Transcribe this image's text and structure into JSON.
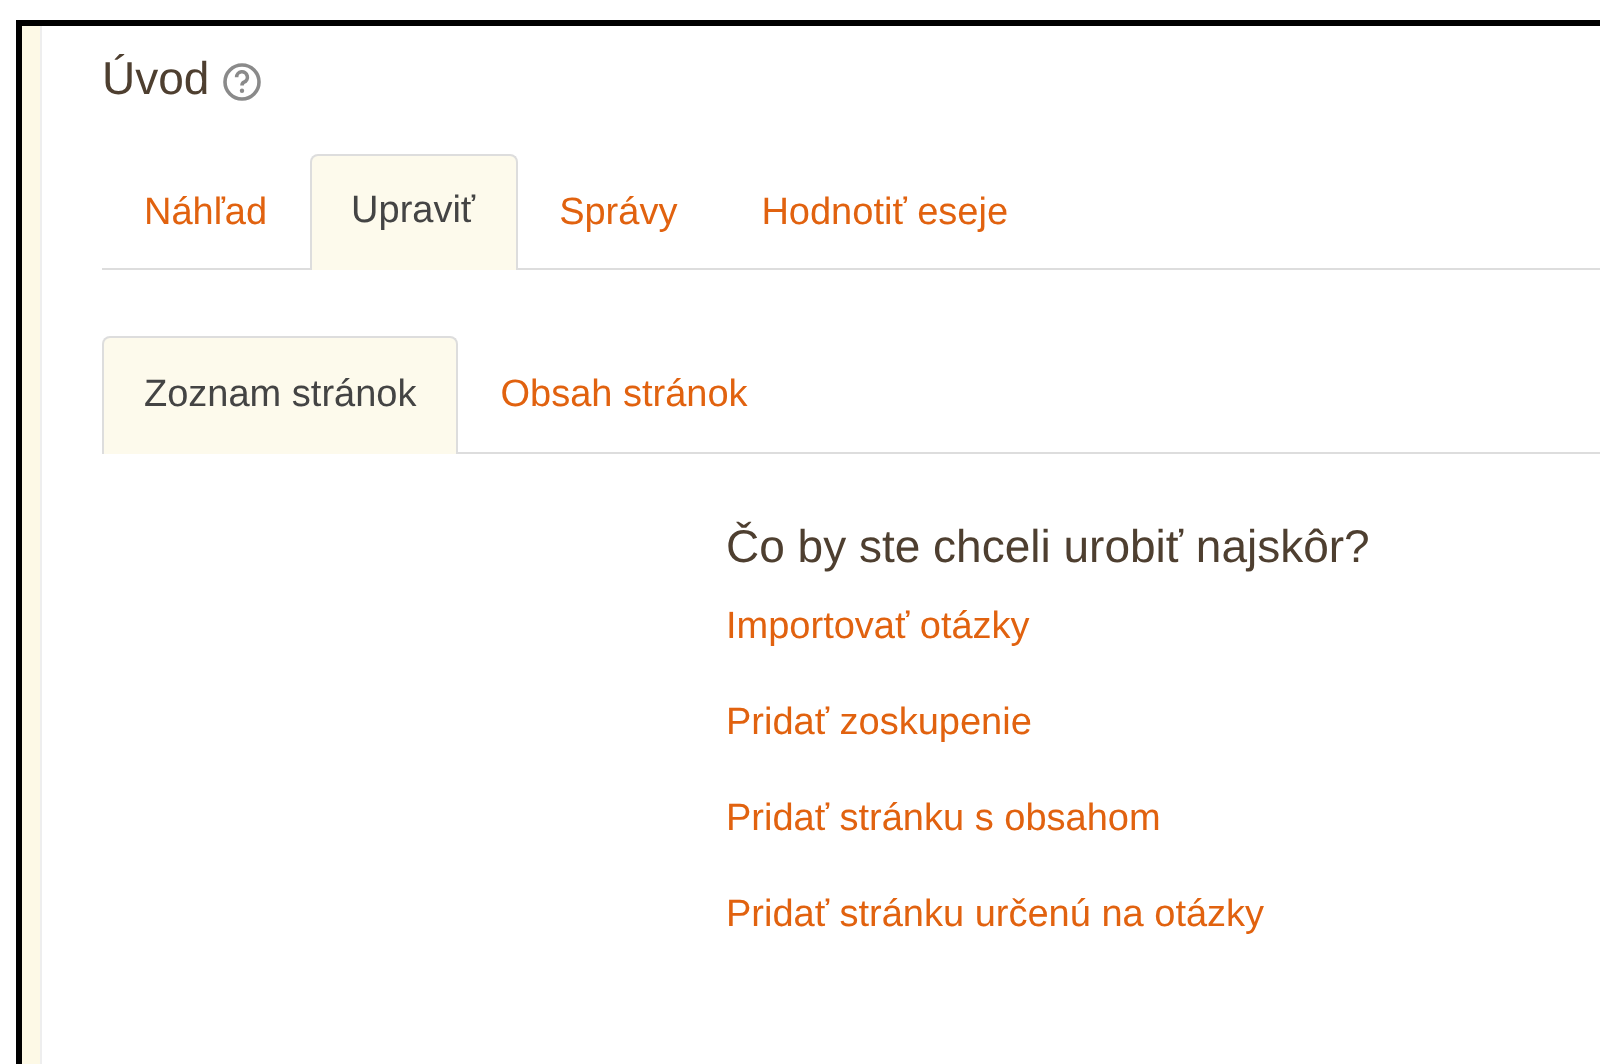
{
  "page_title": "Úvod",
  "tabs": [
    {
      "label": "Náhľad",
      "selected": false
    },
    {
      "label": "Upraviť",
      "selected": true
    },
    {
      "label": "Správy",
      "selected": false
    },
    {
      "label": "Hodnotiť eseje",
      "selected": false
    }
  ],
  "subtabs": [
    {
      "label": "Zoznam stránok",
      "selected": true
    },
    {
      "label": "Obsah stránok",
      "selected": false
    }
  ],
  "prompt": "Čo by ste chceli urobiť najskôr?",
  "actions": [
    "Importovať otázky",
    "Pridať zoskupenie",
    "Pridať stránku s obsahom",
    "Pridať stránku určenú na otázky"
  ]
}
